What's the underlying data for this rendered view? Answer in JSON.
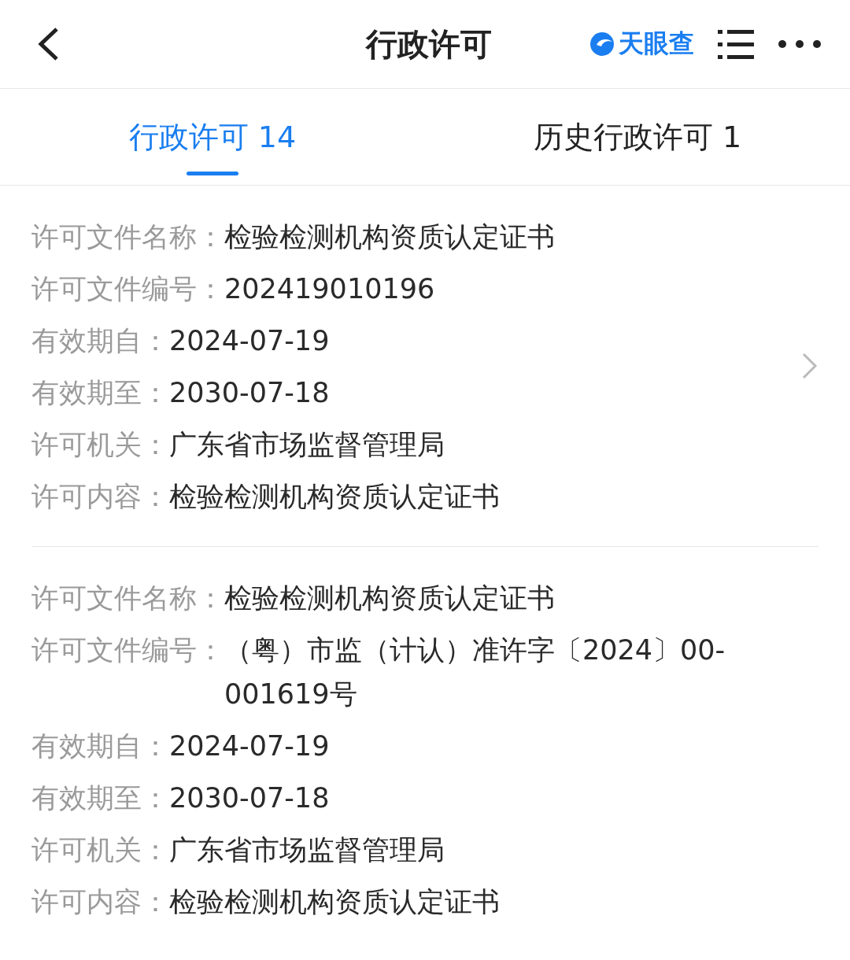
{
  "header": {
    "title": "行政许可",
    "logo_text": "天眼查"
  },
  "tabs": [
    {
      "label": "行政许可 14",
      "selected": true
    },
    {
      "label": "历史行政许可 1",
      "selected": false
    }
  ],
  "records": [
    {
      "has_arrow": true,
      "fields": [
        {
          "label": "许可文件名称：",
          "value": "检验检测机构资质认定证书"
        },
        {
          "label": "许可文件编号：",
          "value": "202419010196"
        },
        {
          "label": "有效期自：",
          "value": "2024-07-19"
        },
        {
          "label": "有效期至：",
          "value": "2030-07-18"
        },
        {
          "label": "许可机关：",
          "value": "广东省市场监督管理局"
        },
        {
          "label": "许可内容：",
          "value": "检验检测机构资质认定证书"
        }
      ]
    },
    {
      "has_arrow": false,
      "fields": [
        {
          "label": "许可文件名称：",
          "value": "检验检测机构资质认定证书"
        },
        {
          "label": "许可文件编号：",
          "value": "（粤）市监（计认）准许字〔2024〕00-001619号"
        },
        {
          "label": "有效期自：",
          "value": "2024-07-19"
        },
        {
          "label": "有效期至：",
          "value": "2030-07-18"
        },
        {
          "label": "许可机关：",
          "value": "广东省市场监督管理局"
        },
        {
          "label": "许可内容：",
          "value": "检验检测机构资质认定证书"
        }
      ]
    }
  ]
}
